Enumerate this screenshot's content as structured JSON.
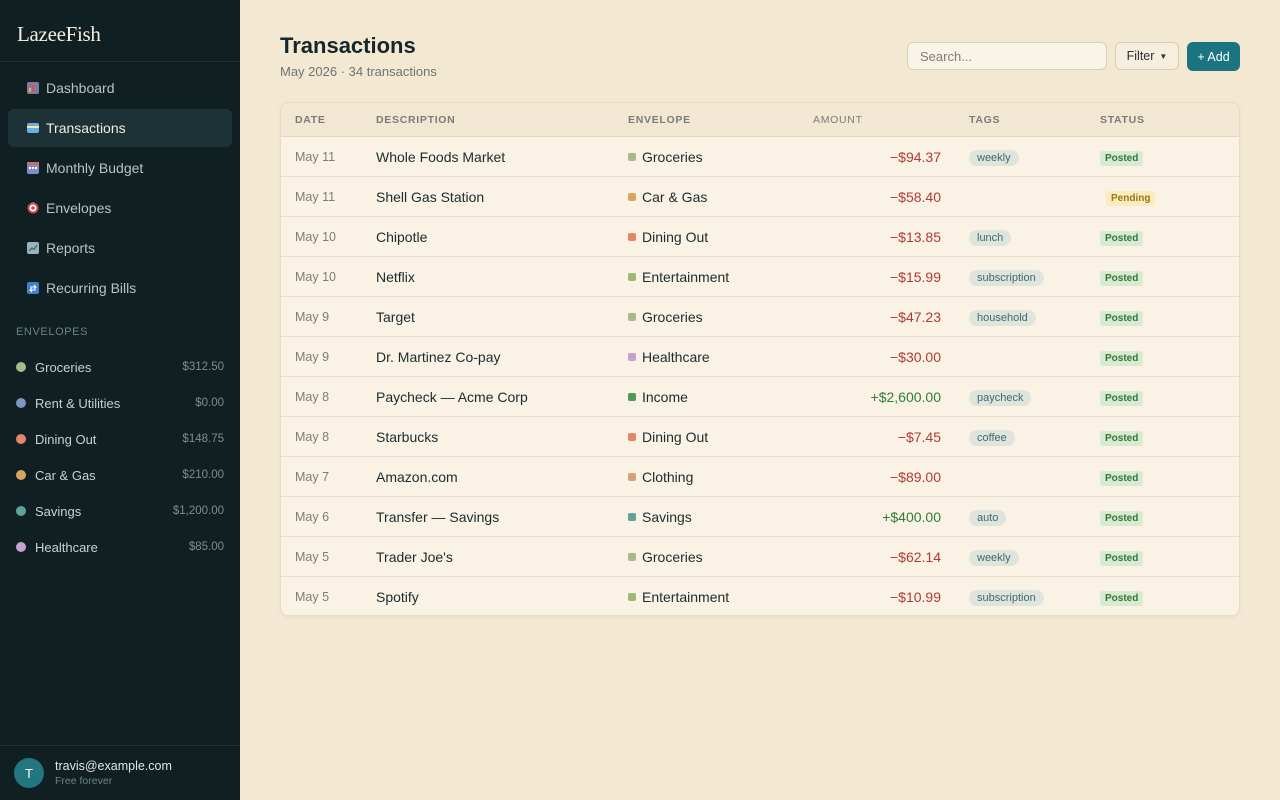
{
  "app": {
    "name": "LazeeFish"
  },
  "nav": [
    {
      "label": "Dashboard",
      "icon": "dashboard-icon",
      "active": false
    },
    {
      "label": "Transactions",
      "icon": "transactions-icon",
      "active": true
    },
    {
      "label": "Monthly Budget",
      "icon": "calendar-icon",
      "active": false
    },
    {
      "label": "Envelopes",
      "icon": "target-icon",
      "active": false
    },
    {
      "label": "Reports",
      "icon": "chart-icon",
      "active": false
    },
    {
      "label": "Recurring Bills",
      "icon": "repeat-icon",
      "active": false
    }
  ],
  "envelopes_section": {
    "title": "ENVELOPES",
    "items": [
      {
        "name": "Groceries",
        "amount": "$312.50",
        "color": "#a9b98a"
      },
      {
        "name": "Rent & Utilities",
        "amount": "$0.00",
        "color": "#7f96c4"
      },
      {
        "name": "Dining Out",
        "amount": "$148.75",
        "color": "#e2876a"
      },
      {
        "name": "Car & Gas",
        "amount": "$210.00",
        "color": "#d9a460"
      },
      {
        "name": "Savings",
        "amount": "$1,200.00",
        "color": "#5fa39c"
      },
      {
        "name": "Healthcare",
        "amount": "$85.00",
        "color": "#c4a2cf"
      }
    ]
  },
  "user": {
    "initial": "T",
    "email": "travis@example.com",
    "plan": "Free forever"
  },
  "header": {
    "title": "Transactions",
    "subtitle": "May 2026 · 34 transactions",
    "search_placeholder": "Search...",
    "filter_label": "Filter",
    "add_label": "+ Add"
  },
  "table": {
    "columns": [
      "DATE",
      "DESCRIPTION",
      "ENVELOPE",
      "AMOUNT",
      "TAGS",
      "STATUS"
    ],
    "rows": [
      {
        "date": "May 11",
        "description": "Whole Foods Market",
        "envelope": "Groceries",
        "env_color": "#a9b98a",
        "amount": "−$94.37",
        "sign": "neg",
        "tag": "weekly",
        "status": "Posted"
      },
      {
        "date": "May 11",
        "description": "Shell Gas Station",
        "envelope": "Car & Gas",
        "env_color": "#d9a460",
        "amount": "−$58.40",
        "sign": "neg",
        "tag": "",
        "status": "Pending"
      },
      {
        "date": "May 10",
        "description": "Chipotle",
        "envelope": "Dining Out",
        "env_color": "#e2876a",
        "amount": "−$13.85",
        "sign": "neg",
        "tag": "lunch",
        "status": "Posted"
      },
      {
        "date": "May 10",
        "description": "Netflix",
        "envelope": "Entertainment",
        "env_color": "#9db86f",
        "amount": "−$15.99",
        "sign": "neg",
        "tag": "subscription",
        "status": "Posted"
      },
      {
        "date": "May 9",
        "description": "Target",
        "envelope": "Groceries",
        "env_color": "#a9b98a",
        "amount": "−$47.23",
        "sign": "neg",
        "tag": "household",
        "status": "Posted"
      },
      {
        "date": "May 9",
        "description": "Dr. Martinez Co-pay",
        "envelope": "Healthcare",
        "env_color": "#c4a2cf",
        "amount": "−$30.00",
        "sign": "neg",
        "tag": "",
        "status": "Posted"
      },
      {
        "date": "May 8",
        "description": "Paycheck — Acme Corp",
        "envelope": "Income",
        "env_color": "#4f9a5b",
        "amount": "+$2,600.00",
        "sign": "pos",
        "tag": "paycheck",
        "status": "Posted"
      },
      {
        "date": "May 8",
        "description": "Starbucks",
        "envelope": "Dining Out",
        "env_color": "#e2876a",
        "amount": "−$7.45",
        "sign": "neg",
        "tag": "coffee",
        "status": "Posted"
      },
      {
        "date": "May 7",
        "description": "Amazon.com",
        "envelope": "Clothing",
        "env_color": "#d3a27a",
        "amount": "−$89.00",
        "sign": "neg",
        "tag": "",
        "status": "Posted"
      },
      {
        "date": "May 6",
        "description": "Transfer — Savings",
        "envelope": "Savings",
        "env_color": "#5fa39c",
        "amount": "+$400.00",
        "sign": "pos",
        "tag": "auto",
        "status": "Posted"
      },
      {
        "date": "May 5",
        "description": "Trader Joe's",
        "envelope": "Groceries",
        "env_color": "#a9b98a",
        "amount": "−$62.14",
        "sign": "neg",
        "tag": "weekly",
        "status": "Posted"
      },
      {
        "date": "May 5",
        "description": "Spotify",
        "envelope": "Entertainment",
        "env_color": "#9db86f",
        "amount": "−$10.99",
        "sign": "neg",
        "tag": "subscription",
        "status": "Posted"
      }
    ]
  }
}
